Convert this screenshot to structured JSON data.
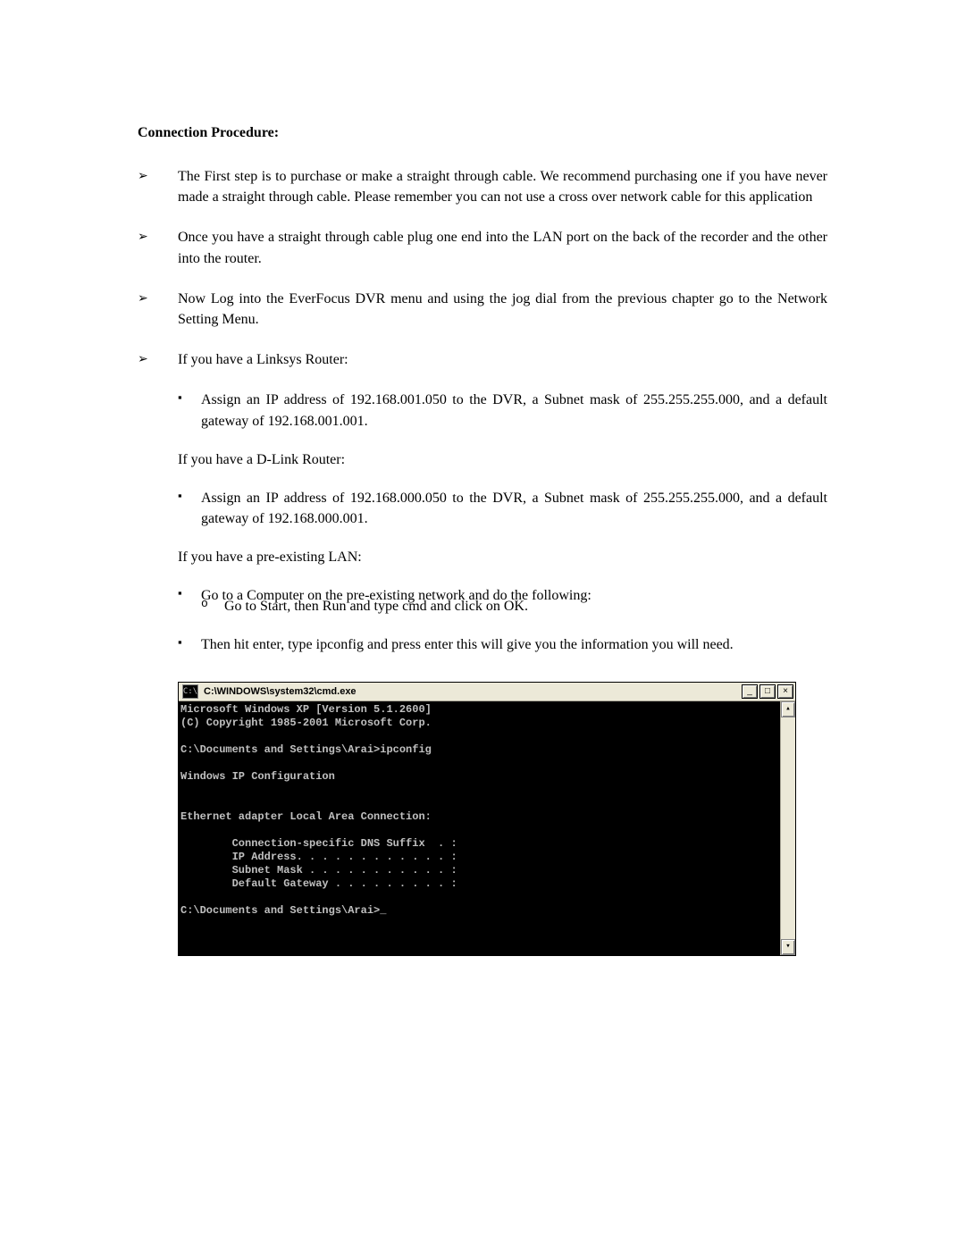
{
  "heading": "Connection Procedure:",
  "bullets": [
    "The First step is to purchase or make a straight through cable. We recommend purchasing one if you have never made a straight through cable. Please remember you can not use a cross over network cable for this application",
    "Once you have a straight through cable plug one end into the LAN port on the back of the recorder and the other into the router.",
    "Now Log into the EverFocus DVR menu and using the jog dial from the previous chapter go to the Network Setting Menu.",
    "If you have a Linksys Router:"
  ],
  "sub": {
    "linksys": "Assign an IP address of 192.168.001.050 to the DVR, a Subnet mask of 255.255.255.000, and a default gateway of 192.168.001.001.",
    "dlink_label": "If you have a D-Link Router:",
    "dlink": "Assign an IP address of 192.168.000.050 to the DVR, a Subnet mask of 255.255.255.000, and a default gateway of 192.168.000.001.",
    "prelan_label": "If you have a pre-existing LAN:",
    "prelan_step1": "Go to a Computer on the pre-existing network and do the following:",
    "prelan_step1_sub": "Go to Start, then Run and type cmd and click on OK.",
    "prelan_step2": "Then hit enter, type ipconfig and press enter this will give you the information you will need."
  },
  "markers": {
    "l1": "➢",
    "l2": "▪",
    "l3": "o"
  },
  "cmd": {
    "title": "C:\\WINDOWS\\system32\\cmd.exe",
    "icon_label": "C:\\",
    "lines": "Microsoft Windows XP [Version 5.1.2600]\n(C) Copyright 1985-2001 Microsoft Corp.\n\nC:\\Documents and Settings\\Arai>ipconfig\n\nWindows IP Configuration\n\n\nEthernet adapter Local Area Connection:\n\n        Connection-specific DNS Suffix  . :\n        IP Address. . . . . . . . . . . . :\n        Subnet Mask . . . . . . . . . . . :\n        Default Gateway . . . . . . . . . :\n\nC:\\Documents and Settings\\Arai>_",
    "btn_min": "_",
    "btn_max": "□",
    "btn_close": "×",
    "arrow_up": "▴",
    "arrow_down": "▾"
  }
}
